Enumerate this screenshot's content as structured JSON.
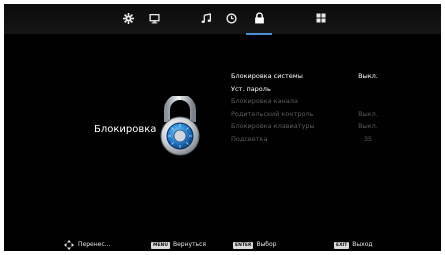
{
  "topbar": {
    "tabs": [
      {
        "icon": "gear-icon"
      },
      {
        "icon": "monitor-icon"
      },
      {
        "icon": "music-note-icon"
      },
      {
        "icon": "clock-icon"
      },
      {
        "icon": "lock-icon",
        "active": true
      },
      {
        "icon": "apps-grid-icon"
      }
    ]
  },
  "section": {
    "title": "Блокировка",
    "icon": "padlock-icon"
  },
  "menu": {
    "items": [
      {
        "label": "Блокировка системы",
        "value": "Выкл.",
        "state": "on"
      },
      {
        "label": "Уст. пароль",
        "value": "",
        "state": "selected"
      },
      {
        "label": "Блокировка канала",
        "value": "",
        "state": "off"
      },
      {
        "label": "Родительский контроль",
        "value": "Выкл.",
        "state": "off"
      },
      {
        "label": "Блокировка клавиатуры",
        "value": "Выкл.",
        "state": "off"
      },
      {
        "label": "Подсветка",
        "value": "35",
        "state": "off"
      }
    ]
  },
  "bottombar": {
    "move_label": "Перенес...",
    "menu_key": "MENU",
    "menu_label": "Вернуться",
    "enter_key": "ENTER",
    "enter_label": "Выбор",
    "exit_key": "EXIT",
    "exit_label": "Выход"
  },
  "colors": {
    "background": "#000000",
    "text": "#ffffff",
    "disabled_text": "#5c5c5c",
    "accent": "#4a90d9"
  }
}
